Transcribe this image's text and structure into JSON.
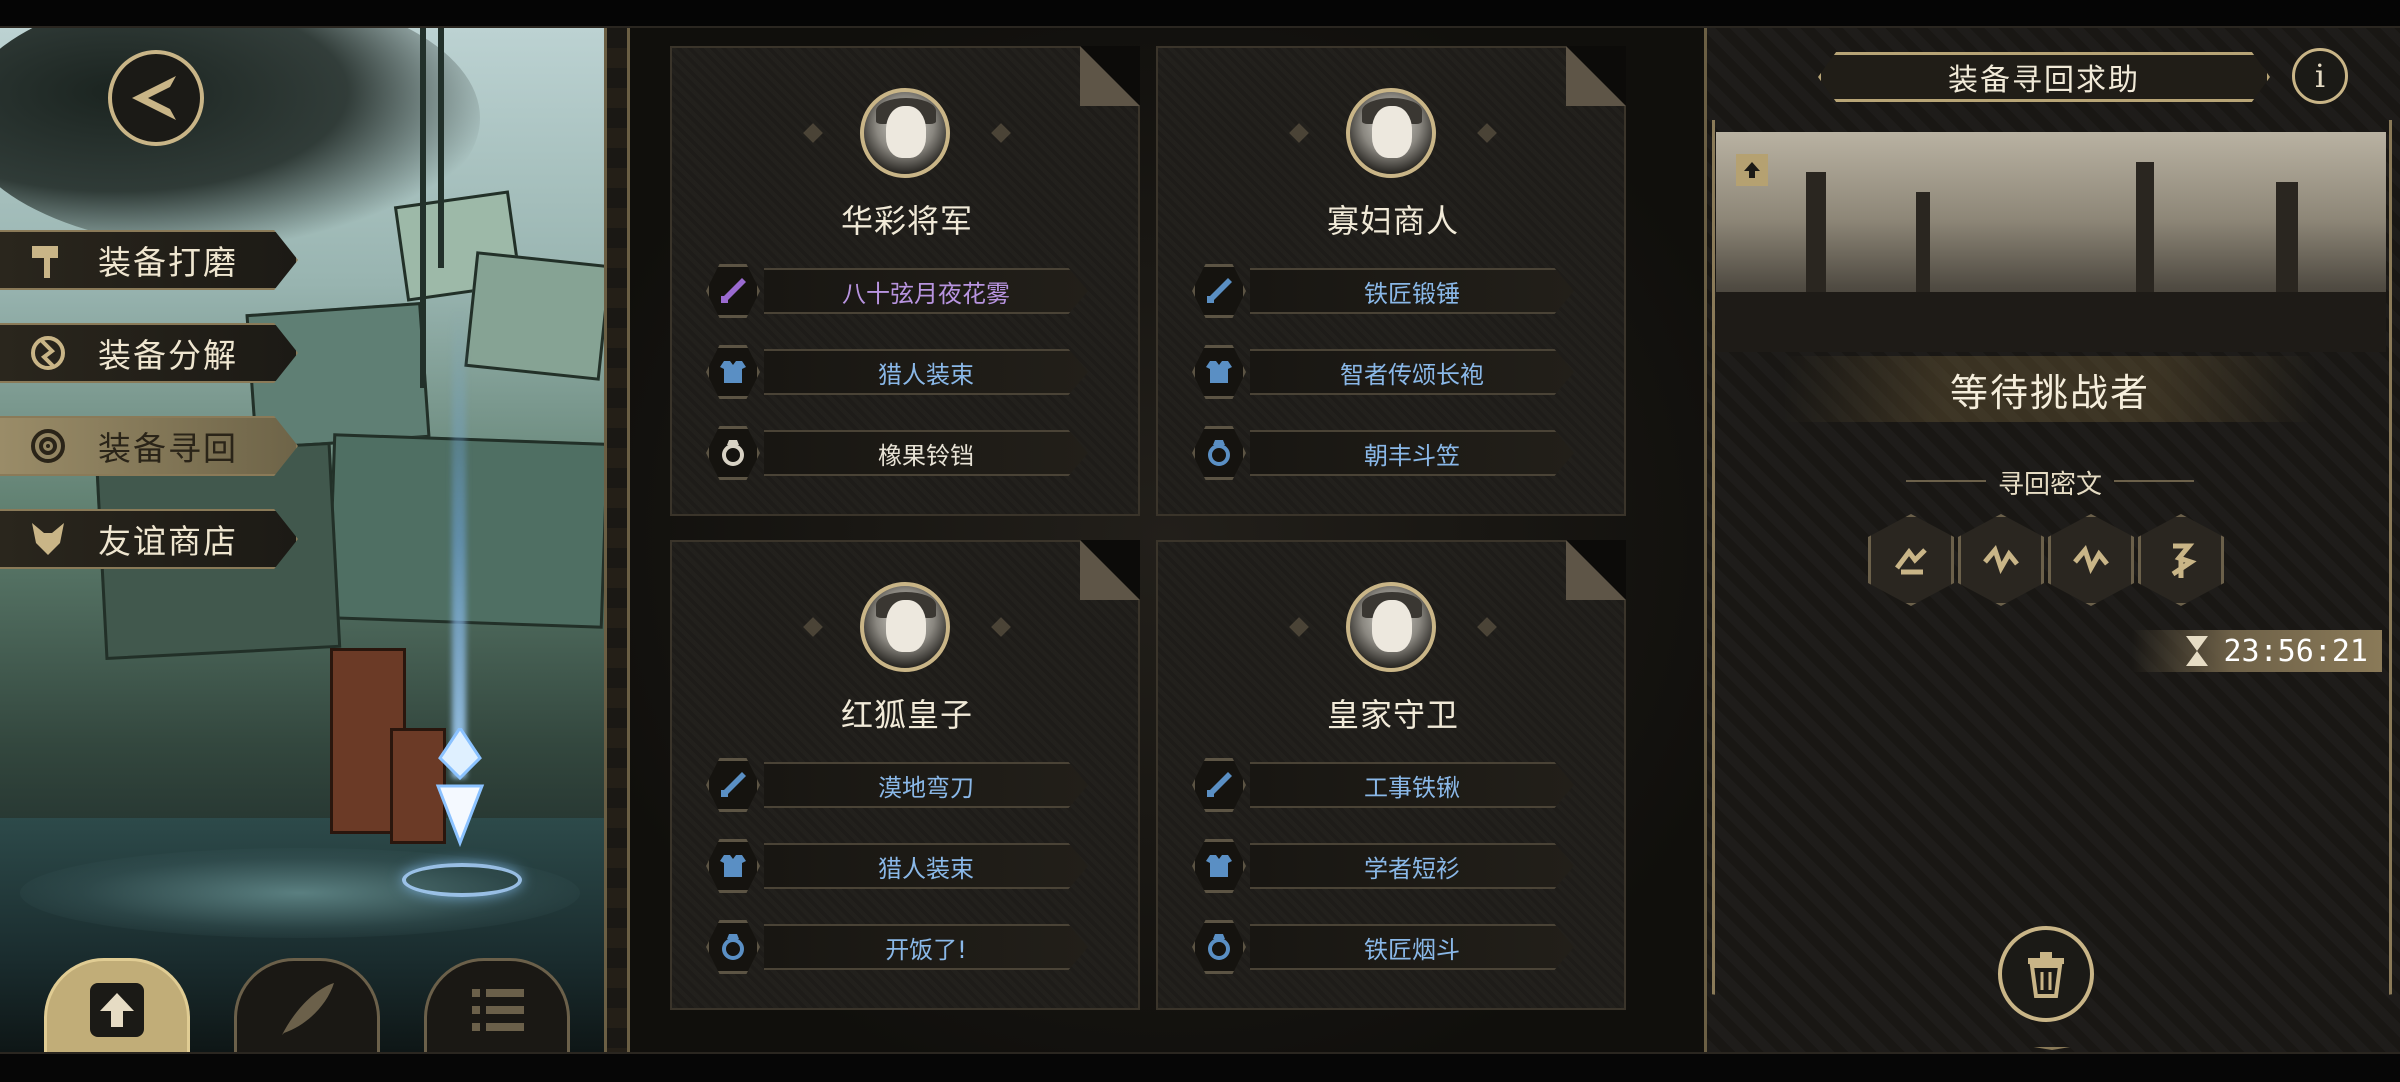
{
  "nav": {
    "menu": [
      {
        "label": "装备打磨",
        "icon": "hammer-icon"
      },
      {
        "label": "装备分解",
        "icon": "disassemble-icon"
      },
      {
        "label": "装备寻回",
        "icon": "target-icon",
        "active": true
      },
      {
        "label": "友谊商店",
        "icon": "fox-icon"
      }
    ],
    "bottom_tabs": [
      {
        "icon": "upload-icon",
        "active": true
      },
      {
        "icon": "feather-icon",
        "active": false
      },
      {
        "icon": "list-icon",
        "active": false
      }
    ]
  },
  "cards": [
    {
      "name": "华彩将军",
      "items": [
        {
          "slot": "weapon",
          "label": "八十弦月夜花雾",
          "rarity": "purple"
        },
        {
          "slot": "armor",
          "label": "猎人装束",
          "rarity": "blue"
        },
        {
          "slot": "accessory",
          "label": "橡果铃铛",
          "rarity": "white"
        }
      ]
    },
    {
      "name": "寡妇商人",
      "items": [
        {
          "slot": "weapon",
          "label": "铁匠锻锤",
          "rarity": "blue"
        },
        {
          "slot": "armor",
          "label": "智者传颂长袍",
          "rarity": "blue"
        },
        {
          "slot": "accessory",
          "label": "朝丰斗笠",
          "rarity": "blue"
        }
      ]
    },
    {
      "name": "红狐皇子",
      "items": [
        {
          "slot": "weapon",
          "label": "漠地弯刀",
          "rarity": "blue"
        },
        {
          "slot": "armor",
          "label": "猎人装束",
          "rarity": "blue"
        },
        {
          "slot": "accessory",
          "label": "开饭了!",
          "rarity": "blue"
        }
      ]
    },
    {
      "name": "皇家守卫",
      "items": [
        {
          "slot": "weapon",
          "label": "工事铁锹",
          "rarity": "blue"
        },
        {
          "slot": "armor",
          "label": "学者短衫",
          "rarity": "blue"
        },
        {
          "slot": "accessory",
          "label": "铁匠烟斗",
          "rarity": "blue"
        }
      ]
    }
  ],
  "panel": {
    "title": "装备寻回求助",
    "info_icon": "i",
    "status": "等待挑战者",
    "cipher_label": "寻回密文",
    "timer": "23:56:21"
  },
  "colors": {
    "gold": "#c9b587",
    "blue_item": "#8ab8e8",
    "purple_item": "#b894e0",
    "white_item": "#e8e3d6"
  }
}
